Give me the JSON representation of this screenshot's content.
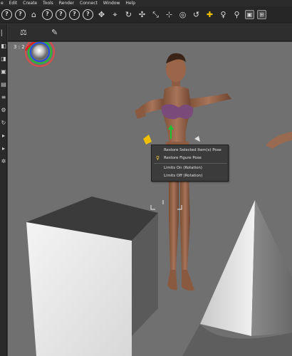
{
  "menu": {
    "items": [
      "e",
      "Edit",
      "Create",
      "Tools",
      "Render",
      "Connect",
      "Window",
      "Help"
    ]
  },
  "toolbar": {
    "icons": [
      "question-icon",
      "question-icon",
      "home-icon",
      "question-icon",
      "question-icon",
      "question-icon",
      "question-icon",
      "universal-tool-icon",
      "node-select-icon",
      "rotate-tool-icon",
      "translate-tool-icon",
      "scale-tool-icon",
      "joint-editor-icon",
      "surface-selection-icon",
      "active-pose-icon",
      "translate-gizmo-icon",
      "figure-icon",
      "bone-icon",
      "camera-cube-icon",
      "region-nav-icon"
    ]
  },
  "viewport": {
    "label": "3 : 2",
    "header_tools": [
      "pose-tool-icon",
      "pin-icon"
    ]
  },
  "context_menu": {
    "items": [
      {
        "label": "Restore Selected Item(s) Pose",
        "icon": ""
      },
      {
        "label": "Restore Figure Pose",
        "icon": "figure-pose-icon"
      },
      {
        "label": "Limits On (Rotation)",
        "icon": ""
      },
      {
        "label": "Limits Off (Rotation)",
        "icon": ""
      }
    ]
  },
  "colors": {
    "background": "#747474",
    "menu_bg": "#3b3b3b",
    "gizmo_red": "#e02020",
    "gizmo_green": "#20c030",
    "gizmo_blue": "#2050e0",
    "gizmo_gold": "#f0c000",
    "skin": "#9b6a4c",
    "bra": "#7a4a7a"
  }
}
